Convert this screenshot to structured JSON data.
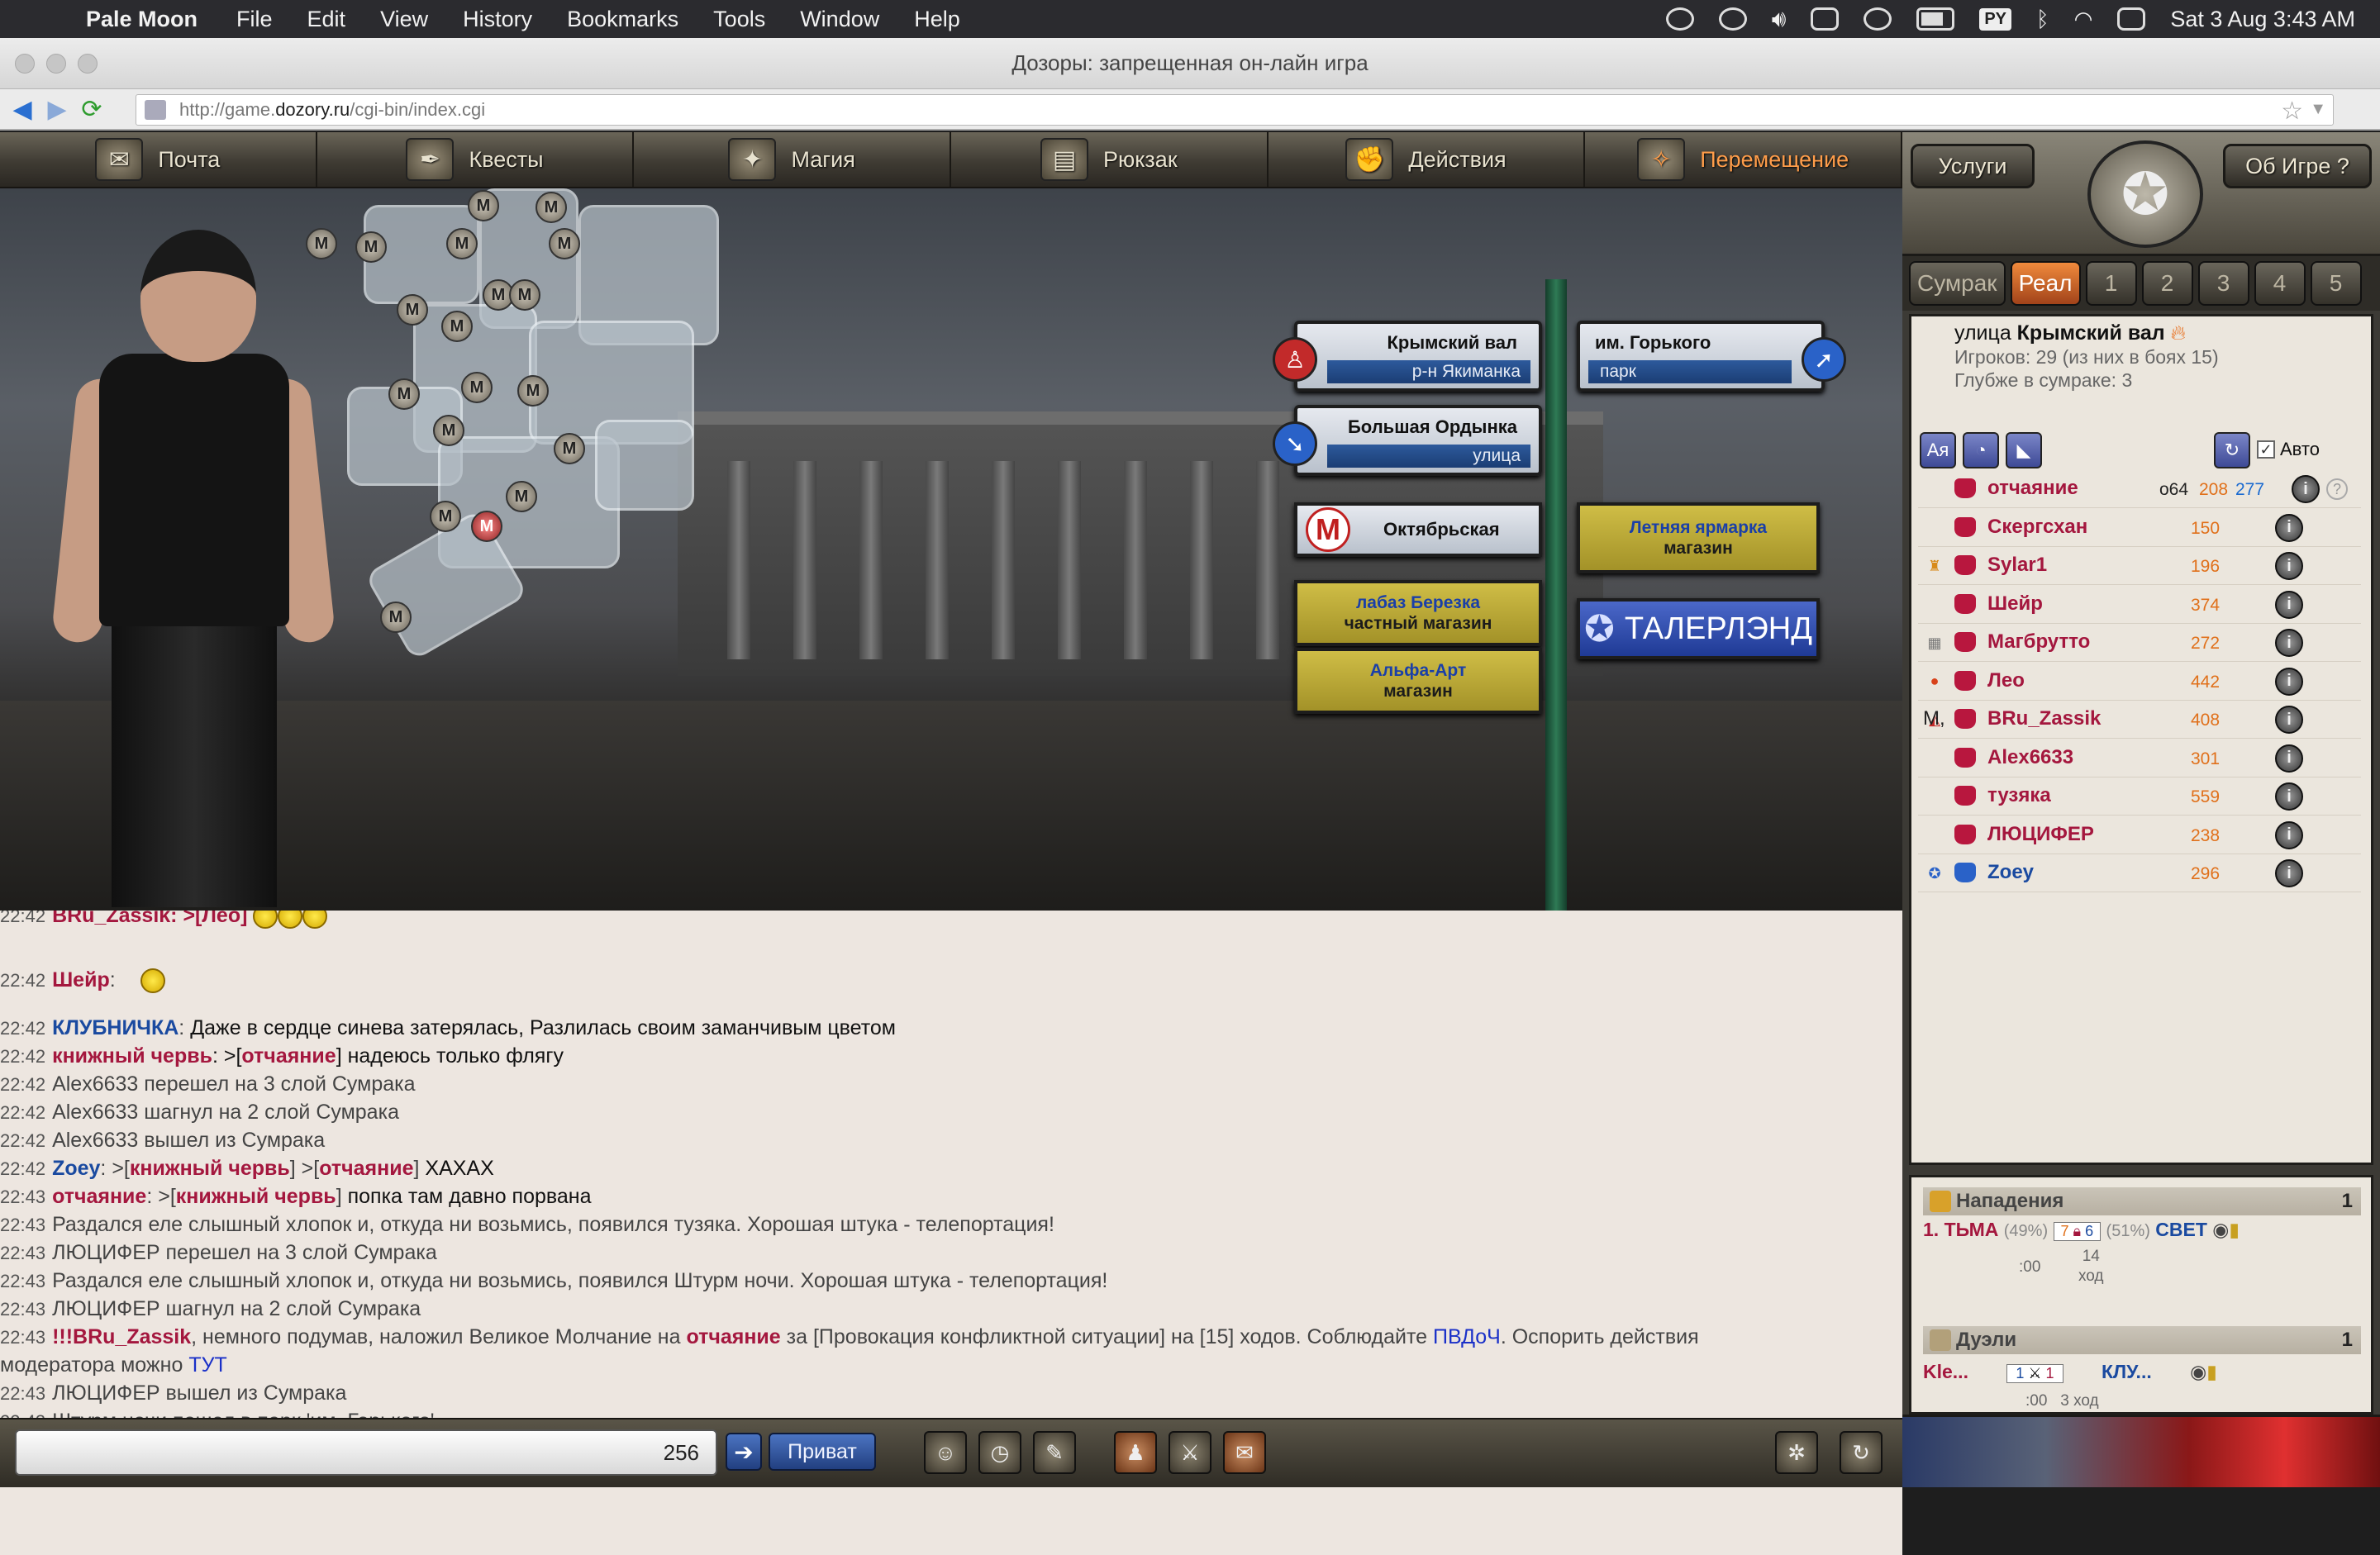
{
  "menubar": {
    "app": "Pale Moon",
    "items": [
      "File",
      "Edit",
      "View",
      "History",
      "Bookmarks",
      "Tools",
      "Window",
      "Help"
    ],
    "tray_badge": "PY",
    "clock": "Sat 3 Aug  3:43 AM"
  },
  "window": {
    "title": "Дозоры: запрещенная он-лайн игра"
  },
  "url": {
    "prefix": "http://game.",
    "domain": "dozory.ru",
    "suffix": "/cgi-bin/index.cgi"
  },
  "topnav": [
    {
      "label": "Почта",
      "icon": "envelope-icon"
    },
    {
      "label": "Квесты",
      "icon": "quill-icon"
    },
    {
      "label": "Магия",
      "icon": "magic-spark-icon"
    },
    {
      "label": "Рюкзак",
      "icon": "backpack-icon"
    },
    {
      "label": "Действия",
      "icon": "fist-icon"
    },
    {
      "label": "Перемещение",
      "icon": "compass-icon",
      "active": true
    }
  ],
  "map": {
    "badge_letter": "M"
  },
  "signs": {
    "left1": {
      "name": "Крымский вал",
      "sub": "р-н Якиманка"
    },
    "right1": {
      "name": "им. Горького",
      "sub": "парк"
    },
    "left2": {
      "name": "Большая Ордынка",
      "sub": "улица"
    },
    "metro": {
      "letter": "M",
      "name": "Октябрьская"
    },
    "fair": {
      "line1": "Летняя ярмарка",
      "line2": "магазин"
    },
    "shop1": {
      "line1": "лабаз Березка",
      "line2": "частный магазин"
    },
    "shop2": {
      "line1": "Альфа-Арт",
      "line2": "магазин"
    },
    "taler": "ТАЛЕРЛЭНД"
  },
  "chat": [
    {
      "t": "22:42",
      "parts": [
        {
          "c": "nm-red",
          "v": "Шейр"
        },
        {
          "c": "",
          "v": ":"
        }
      ]
    },
    {
      "t": "22:42",
      "parts": [
        {
          "c": "nm-blue",
          "v": "КЛУБНИЧКА"
        },
        {
          "c": "",
          "v": ":  "
        },
        {
          "c": "msg",
          "v": "Даже в сердце синева затерялась, Разлилась своим заманчивым цветом"
        }
      ]
    },
    {
      "t": "22:42",
      "parts": [
        {
          "c": "nm-red",
          "v": "книжный червь"
        },
        {
          "c": "msg",
          "v": ": >["
        },
        {
          "c": "nm-red",
          "v": "отчаяние"
        },
        {
          "c": "msg",
          "v": "]  надеюсь только флягу"
        }
      ]
    },
    {
      "t": "22:42",
      "parts": [
        {
          "c": "",
          "v": "Alex6633 перешел на 3 слой Сумрака"
        }
      ]
    },
    {
      "t": "22:42",
      "parts": [
        {
          "c": "",
          "v": "Alex6633 шагнул на 2 слой Сумрака"
        }
      ]
    },
    {
      "t": "22:42",
      "parts": [
        {
          "c": "",
          "v": "Alex6633 вышел из Сумрака"
        }
      ]
    },
    {
      "t": "22:42",
      "parts": [
        {
          "c": "nm-blue",
          "v": "Zoey"
        },
        {
          "c": "",
          "v": ": >["
        },
        {
          "c": "nm-red",
          "v": "книжный червь"
        },
        {
          "c": "",
          "v": "] >["
        },
        {
          "c": "nm-red",
          "v": "отчаяние"
        },
        {
          "c": "",
          "v": "]  "
        },
        {
          "c": "msg",
          "v": "ХАХАХ"
        }
      ]
    },
    {
      "t": "22:43",
      "parts": [
        {
          "c": "nm-red",
          "v": "отчаяние"
        },
        {
          "c": "",
          "v": ": >["
        },
        {
          "c": "nm-red",
          "v": "книжный червь"
        },
        {
          "c": "",
          "v": "]  "
        },
        {
          "c": "msg",
          "v": "попка там давно порвана"
        }
      ]
    },
    {
      "t": "22:43",
      "parts": [
        {
          "c": "",
          "v": "Раздался еле слышный хлопок и, откуда ни возьмись, появился тузяка. Хорошая штука - телепортация!"
        }
      ]
    },
    {
      "t": "22:43",
      "parts": [
        {
          "c": "",
          "v": "ЛЮЦИФЕР перешел на 3 слой Сумрака"
        }
      ]
    },
    {
      "t": "22:43",
      "parts": [
        {
          "c": "",
          "v": "Раздался еле слышный хлопок и, откуда ни возьмись, появился Штурм ночи. Хорошая штука - телепортация!"
        }
      ]
    },
    {
      "t": "22:43",
      "parts": [
        {
          "c": "",
          "v": "ЛЮЦИФЕР шагнул на 2 слой Сумрака"
        }
      ]
    },
    {
      "t": "22:43",
      "parts": [
        {
          "c": "nm-red",
          "v": "!!!BRu_Zassik"
        },
        {
          "c": "",
          "v": ", немного подумав, наложил Великое Молчание на "
        },
        {
          "c": "nm-red",
          "v": "отчаяние"
        },
        {
          "c": "",
          "v": " за [Провокация конфликтной ситуации] на [15] ходов. Соблюдайте "
        },
        {
          "c": "link",
          "v": "ПВДоЧ"
        },
        {
          "c": "",
          "v": ". Оспорить действия"
        }
      ]
    },
    {
      "t": "",
      "parts": [
        {
          "c": "",
          "v": "модератора можно "
        },
        {
          "c": "link",
          "v": "ТУТ"
        }
      ]
    },
    {
      "t": "22:43",
      "parts": [
        {
          "c": "",
          "v": "ЛЮЦИФЕР вышел из Сумрака"
        }
      ]
    },
    {
      "t": "22:43",
      "parts": [
        {
          "c": "",
          "v": "Штурм ночи пошел в парк 'им. Горького'"
        }
      ]
    }
  ],
  "chat_top_cut": "BRu_Zassik: >[Лео]",
  "input": {
    "counter": "256",
    "privat": "Приват"
  },
  "side": {
    "services": "Услуги",
    "about": "Об Игре",
    "help": "?",
    "layers": [
      "Сумрак",
      "Реал",
      "1",
      "2",
      "3",
      "4",
      "5"
    ],
    "location_prefix": "улица ",
    "location_name": "Крымский вал",
    "players_info": "Игроков: 29 (из них в боях 15)",
    "depth_info": "Глубже в сумраке: 3",
    "tool_icons": [
      "Ая",
      "◔",
      "◣"
    ],
    "auto_label": "Авто",
    "players": [
      {
        "name": "отчаяние",
        "extra": "о64",
        "lvl": "208",
        "lvl2": "277",
        "blue": false
      },
      {
        "name": "Скергсхан",
        "lvl": "150",
        "blue": false
      },
      {
        "name": "Sylar1",
        "lvl": "196",
        "blue": false
      },
      {
        "name": "Шейр",
        "lvl": "374",
        "blue": false
      },
      {
        "name": "Магбрутто",
        "lvl": "272",
        "blue": false
      },
      {
        "name": "Лео",
        "lvl": "442",
        "blue": false
      },
      {
        "name": "BRu_Zassik",
        "prefix": "М,",
        "lvl": "408",
        "blue": false
      },
      {
        "name": "Alex6633",
        "lvl": "301",
        "blue": false
      },
      {
        "name": "тузяка",
        "lvl": "559",
        "blue": false
      },
      {
        "name": "ЛЮЦИФЕР",
        "lvl": "238",
        "blue": false
      },
      {
        "name": "Zoey",
        "lvl": "296",
        "blue": true
      }
    ],
    "attacks": {
      "title": "Нападения",
      "count": "1",
      "num": "1.",
      "dark": "ТЬМА",
      "dark_pct": "(49%)",
      "v1": "7",
      "v2": "6",
      "light_pct": "(51%)",
      "light": "СВЕТ",
      "time": ":00",
      "turn": "14",
      "turn_label": "ход"
    },
    "duels": {
      "title": "Дуэли",
      "count": "1",
      "p1": "Kle...",
      "v1": "1",
      "v2": "1",
      "p2": "КЛУ...",
      "time": ":00",
      "turn": "3 ход"
    }
  }
}
